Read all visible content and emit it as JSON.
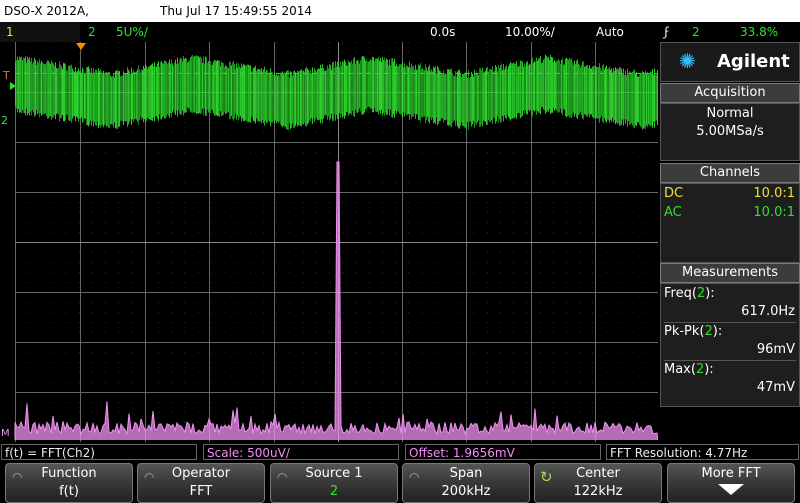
{
  "title_bar": {
    "model": "DSO-X 2012A,",
    "datetime": "Thu Jul 17 15:49:55 2014"
  },
  "status_bar": {
    "ch1_label": "1",
    "ch2_label": "2",
    "ch2_scale": "5U%/",
    "time_delay": "0.0s",
    "time_scale": "10.00%/",
    "trigger_mode": "Auto",
    "trigger_symbol": "ϝ",
    "trigger_source": "2",
    "trigger_level": "33.8%"
  },
  "markers": {
    "trigger_label": "T",
    "ch2_marker": "2",
    "math_marker": "M"
  },
  "panel": {
    "brand": "Agilent",
    "acquisition": {
      "header": "Acquisition",
      "mode": "Normal",
      "rate": "5.00MSa/s"
    },
    "channels": {
      "header": "Channels",
      "rows": [
        {
          "coupling": "DC",
          "probe": "10.0:1",
          "color": "#f0e030"
        },
        {
          "coupling": "AC",
          "probe": "10.0:1",
          "color": "#30e030"
        }
      ]
    },
    "measurements": {
      "header": "Measurements",
      "items": [
        {
          "label": "Freq(",
          "src": "2",
          "close": "):",
          "value": "617.0Hz"
        },
        {
          "label": "Pk-Pk(",
          "src": "2",
          "close": "):",
          "value": "96mV"
        },
        {
          "label": "Max(",
          "src": "2",
          "close": "):",
          "value": "47mV"
        }
      ]
    }
  },
  "info_bar": {
    "function": "f(t) = FFT(Ch2)",
    "scale": "Scale: 500uV/",
    "offset": "Offset: 1.9656mV",
    "resolution": "FFT Resolution: 4.77Hz"
  },
  "softkeys": [
    {
      "line1": "Function",
      "line2": "f(t)"
    },
    {
      "line1": "Operator",
      "line2": "FFT"
    },
    {
      "line1": "Source 1",
      "line2": "2"
    },
    {
      "line1": "Span",
      "line2": "200kHz"
    },
    {
      "line1": "Center",
      "line2": "122kHz"
    },
    {
      "line1": "More FFT",
      "line2": ""
    }
  ],
  "colors": {
    "ch1": "#f0e030",
    "ch2": "#30e030",
    "math": "#f090f0",
    "accent": "#2ec0ff"
  }
}
